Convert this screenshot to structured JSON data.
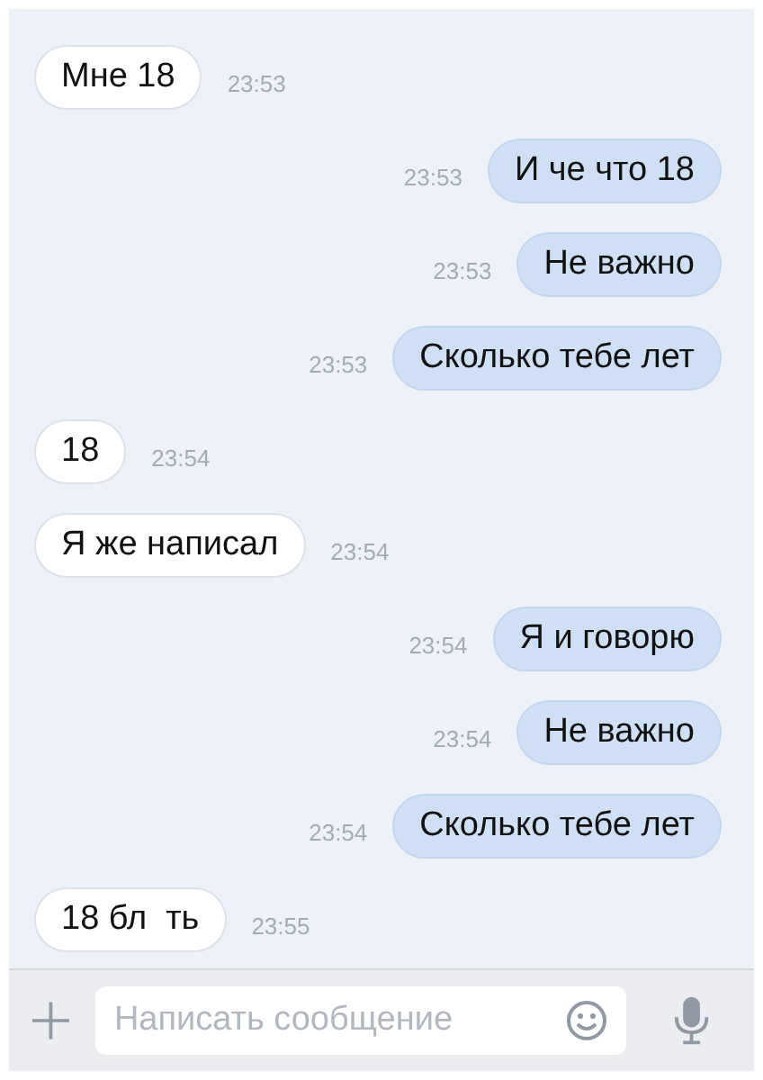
{
  "messages": [
    {
      "kind": "incoming",
      "text": "Мне 18",
      "time": "23:53"
    },
    {
      "kind": "outgoing",
      "text": "И че что 18",
      "time": "23:53"
    },
    {
      "kind": "outgoing",
      "text": "Не важно",
      "time": "23:53"
    },
    {
      "kind": "outgoing",
      "text": "Сколько тебе лет",
      "time": "23:53"
    },
    {
      "kind": "incoming",
      "text": "18",
      "time": "23:54"
    },
    {
      "kind": "incoming",
      "text": "Я же написал",
      "time": "23:54"
    },
    {
      "kind": "outgoing",
      "text": "Я и говорю",
      "time": "23:54"
    },
    {
      "kind": "outgoing",
      "text": "Не важно",
      "time": "23:54"
    },
    {
      "kind": "outgoing",
      "text": "Сколько тебе лет",
      "time": "23:54"
    },
    {
      "kind": "incoming",
      "text": "18 бл  ть",
      "time": "23:55"
    }
  ],
  "composer": {
    "placeholder": "Написать сообщение"
  }
}
